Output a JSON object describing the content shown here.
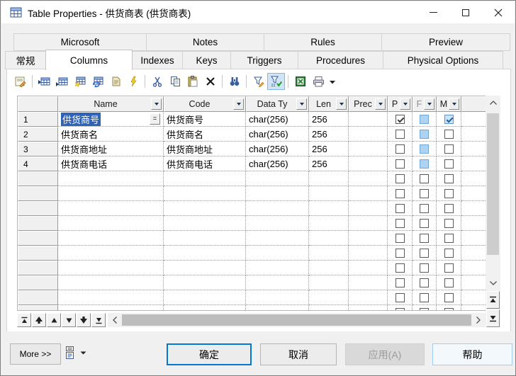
{
  "window": {
    "title": "Table Properties - 供货商表 (供货商表)",
    "controls": {
      "minimize": "minimize",
      "maximize": "maximize",
      "close": "close"
    }
  },
  "tabs": {
    "row1": [
      {
        "label": "Microsoft"
      },
      {
        "label": "Notes"
      },
      {
        "label": "Rules"
      },
      {
        "label": "Preview"
      }
    ],
    "row2": [
      {
        "label": "常规"
      },
      {
        "label": "Columns",
        "active": true
      },
      {
        "label": "Indexes"
      },
      {
        "label": "Keys"
      },
      {
        "label": "Triggers"
      },
      {
        "label": "Procedures"
      },
      {
        "label": "Physical Options"
      }
    ]
  },
  "toolbar": {
    "icons": [
      "properties",
      "insert-row",
      "add-row",
      "add-row-with-new",
      "refresh-columns",
      "copy-note",
      "wizard",
      "cut",
      "copy",
      "paste",
      "delete",
      "find",
      "filter-edit",
      "filter-applied",
      "excel-export",
      "print",
      "menu-caret"
    ],
    "filter_applied_active": true
  },
  "grid": {
    "headers": [
      {
        "label": "Name"
      },
      {
        "label": "Code"
      },
      {
        "label": "Data Ty"
      },
      {
        "label": "Len"
      },
      {
        "label": "Prec"
      },
      {
        "label": "P"
      },
      {
        "label": "F",
        "muted": true
      },
      {
        "label": "M"
      }
    ],
    "name_edit_button": "=",
    "rows": [
      {
        "num": "1",
        "name": "供货商号",
        "code": "供货商号",
        "data_type": "char(256)",
        "length": "256",
        "precision": "",
        "primary": true,
        "foreign": false,
        "mandatory": true,
        "selected": true
      },
      {
        "num": "2",
        "name": "供货商名",
        "code": "供货商名",
        "data_type": "char(256)",
        "length": "256",
        "precision": "",
        "primary": false,
        "foreign": false,
        "mandatory": false
      },
      {
        "num": "3",
        "name": "供货商地址",
        "code": "供货商地址",
        "data_type": "char(256)",
        "length": "256",
        "precision": "",
        "primary": false,
        "foreign": false,
        "mandatory": false
      },
      {
        "num": "4",
        "name": "供货商电话",
        "code": "供货商电话",
        "data_type": "char(256)",
        "length": "256",
        "precision": "",
        "primary": false,
        "foreign": false,
        "mandatory": false
      }
    ],
    "empty_rows": 10
  },
  "footer": {
    "more_label": "More >>",
    "ok_label": "确定",
    "cancel_label": "取消",
    "apply_label": "应用(A)",
    "help_label": "帮助"
  },
  "colors": {
    "selection": "#2e63b8",
    "accent": "#0078d7",
    "f_checkbox_fill": "#aed3f2",
    "m_checked_fill": "#cbe4f9",
    "filter_active_bg": "#cfe4f7"
  }
}
